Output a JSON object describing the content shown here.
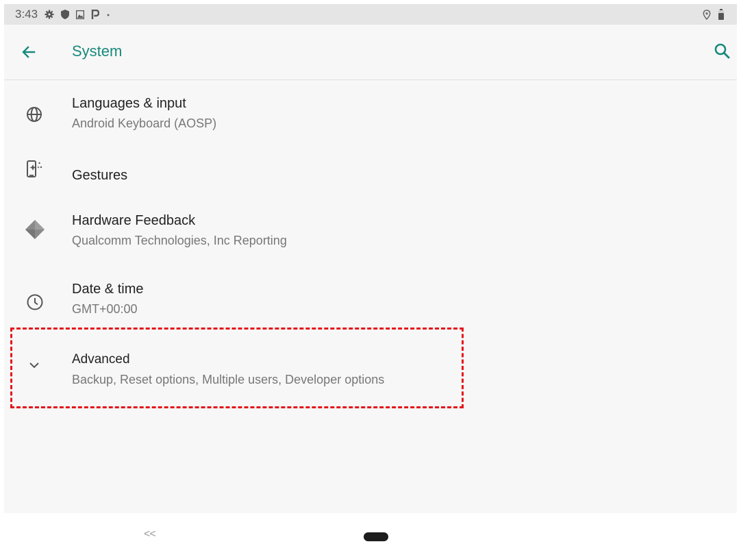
{
  "status_bar": {
    "time": "3:43",
    "left_icons": [
      "settings-icon",
      "shield-icon",
      "image-icon",
      "parking-icon",
      "dot-icon"
    ],
    "right_icons": [
      "location-icon",
      "battery-icon"
    ]
  },
  "app_bar": {
    "title": "System",
    "accent_color": "#188a7c",
    "back_icon": "arrow-back-icon",
    "search_icon": "search-icon"
  },
  "items": [
    {
      "icon": "globe-icon",
      "title": "Languages & input",
      "subtitle": "Android Keyboard (AOSP)"
    },
    {
      "icon": "gestures-icon",
      "title": "Gestures",
      "subtitle": ""
    },
    {
      "icon": "chip-icon",
      "title": "Hardware Feedback",
      "subtitle": "Qualcomm Technologies, Inc Reporting"
    },
    {
      "icon": "clock-icon",
      "title": "Date & time",
      "subtitle": "GMT+00:00"
    },
    {
      "icon": "chevron-down-icon",
      "title": "Advanced",
      "subtitle": "Backup, Reset options, Multiple users, Developer options"
    }
  ],
  "highlight": {
    "color": "#e3161b",
    "target": "Advanced"
  },
  "nav_bar": {
    "back_label": "<<"
  }
}
